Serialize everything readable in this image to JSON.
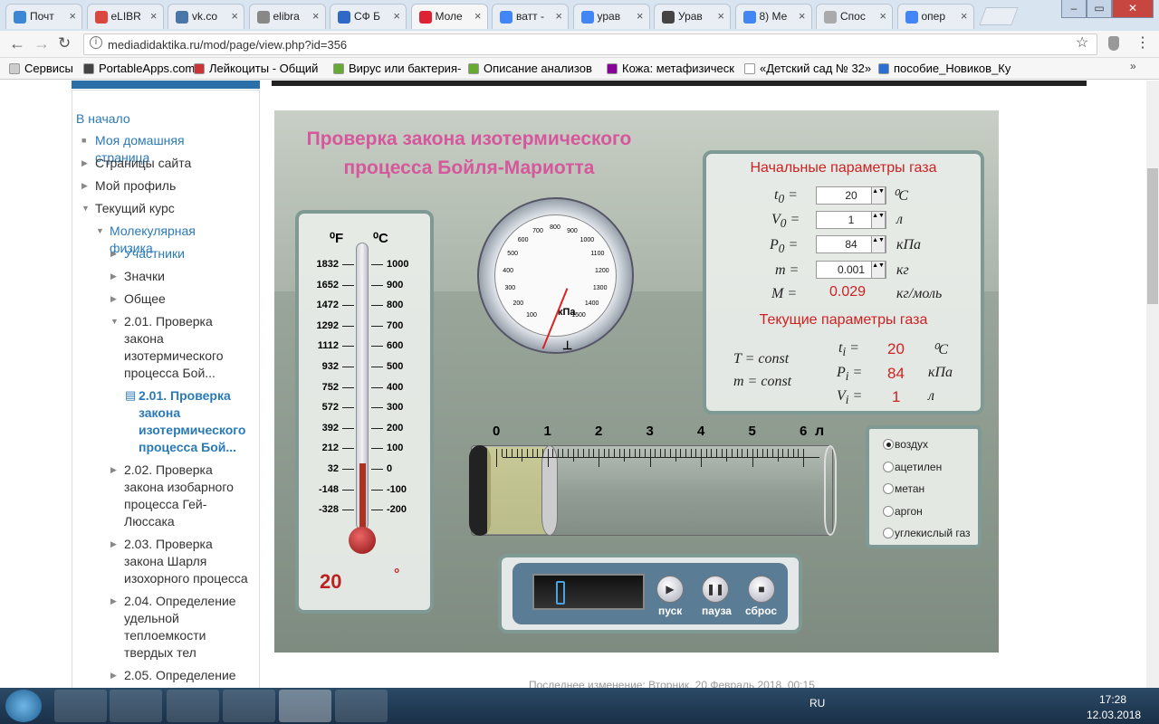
{
  "tabs": [
    {
      "label": "Почт"
    },
    {
      "label": "eLIBR"
    },
    {
      "label": "vk.co"
    },
    {
      "label": "elibra"
    },
    {
      "label": "СФ Б"
    },
    {
      "label": "Моле"
    },
    {
      "label": "ватт -"
    },
    {
      "label": "урав"
    },
    {
      "label": "Урав"
    },
    {
      "label": "8) Ме"
    },
    {
      "label": "Спос"
    },
    {
      "label": "опер"
    }
  ],
  "address": "mediadidaktika.ru/mod/page/view.php?id=356",
  "bookmarks": [
    "Сервисы",
    "PortableApps.com",
    "Лейкоциты - Общий",
    "Вирус или бактерия-",
    "Описание анализов",
    "Кожа: метафизическ",
    "«Детский сад № 32»",
    "пособие_Новиков_Ку"
  ],
  "nav": {
    "home": "В начало",
    "mypage": "Моя домашняя страница",
    "site": "Страницы сайта",
    "profile": "Мой профиль",
    "course": "Текущий курс",
    "molphys": "Молекулярная физика",
    "participants": "Участники",
    "badges": "Значки",
    "general": "Общее",
    "i201a": "2.01. Проверка закона изотермического процесса Бой...",
    "i201b": "2.01. Проверка закона изотермического процесса Бой...",
    "i202": "2.02. Проверка закона изобарного процесса Гей-Люссака",
    "i203": "2.03. Проверка закона Шарля изохорного процесса",
    "i204": "2.04. Определение удельной теплоемкости твердых тел",
    "i205": "2.05. Определение"
  },
  "sim": {
    "title1": "Проверка закона изотермического",
    "title2": "процесса Бойля-Мариотта",
    "init_title": "Начальные параметры газа",
    "t0": "20",
    "V0": "1",
    "P0": "84",
    "m": "0.001",
    "M": "0.029",
    "unit_c": "⁰C",
    "unit_l": "л",
    "unit_kpa": "кПа",
    "unit_kg": "кг",
    "unit_kgmol": "кг/моль",
    "cur_title": "Текущие параметры газа",
    "Tconst": "T = const",
    "mconst": "m = const",
    "ti": "20",
    "Pi": "84",
    "Vi": "1",
    "temp": "20",
    "deg": "°",
    "gauge_unit": "кПа",
    "gases": [
      "воздух",
      "ацетилен",
      "метан",
      "аргон",
      "углекислый газ"
    ],
    "btn_start": "пуск",
    "btn_pause": "пауза",
    "btn_reset": "сброс",
    "liter": "л",
    "F": "⁰F",
    "C": "⁰C",
    "fscale": [
      "1832",
      "1652",
      "1472",
      "1292",
      "1112",
      "932",
      "752",
      "572",
      "392",
      "212",
      "32",
      "-148",
      "-328"
    ],
    "cscale": [
      "1000",
      "900",
      "800",
      "700",
      "600",
      "500",
      "400",
      "300",
      "200",
      "100",
      "0",
      "-100",
      "-200"
    ],
    "gauge_ticks": [
      "100",
      "200",
      "300",
      "400",
      "500",
      "600",
      "700",
      "800",
      "900",
      "1000",
      "1100",
      "1200",
      "1300",
      "1400",
      "1500"
    ],
    "cyl": [
      "0",
      "1",
      "2",
      "3",
      "4",
      "5",
      "6"
    ]
  },
  "footer": "Последнее изменение: Вторник, 20 Февраль 2018, 00:15",
  "tray": {
    "lang": "RU",
    "time": "17:28",
    "date": "12.03.2018"
  }
}
